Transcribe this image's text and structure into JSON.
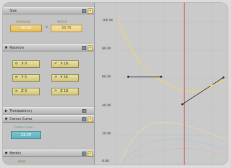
{
  "size": {
    "title": "Size",
    "horizontal_label": "Horizontal",
    "vertical_label": "Vertical",
    "horizontal_value": "50.00",
    "vertical_value": "50.70",
    "separator": "×"
  },
  "rotation": {
    "title": "Rotation",
    "rows": [
      {
        "left": "X 0",
        "right": "X 16"
      },
      {
        "left": "Y 0",
        "right": "Y 36"
      },
      {
        "left": "Z 0",
        "right": "Z 16"
      }
    ]
  },
  "transparency": {
    "title": "Transparency"
  },
  "corner_curve": {
    "title": "Corner Curve",
    "label": "Corner Curve",
    "value": "21.00"
  },
  "border": {
    "title": "Border",
    "label": "Width"
  },
  "graph": {
    "y_ticks": [
      "100.00",
      "80.00",
      "60.00",
      "40.00",
      "20.00",
      "0.00"
    ],
    "colors": {
      "curve": "#ecd27a",
      "playhead": "#c23a3a",
      "handle": "#222222"
    }
  }
}
